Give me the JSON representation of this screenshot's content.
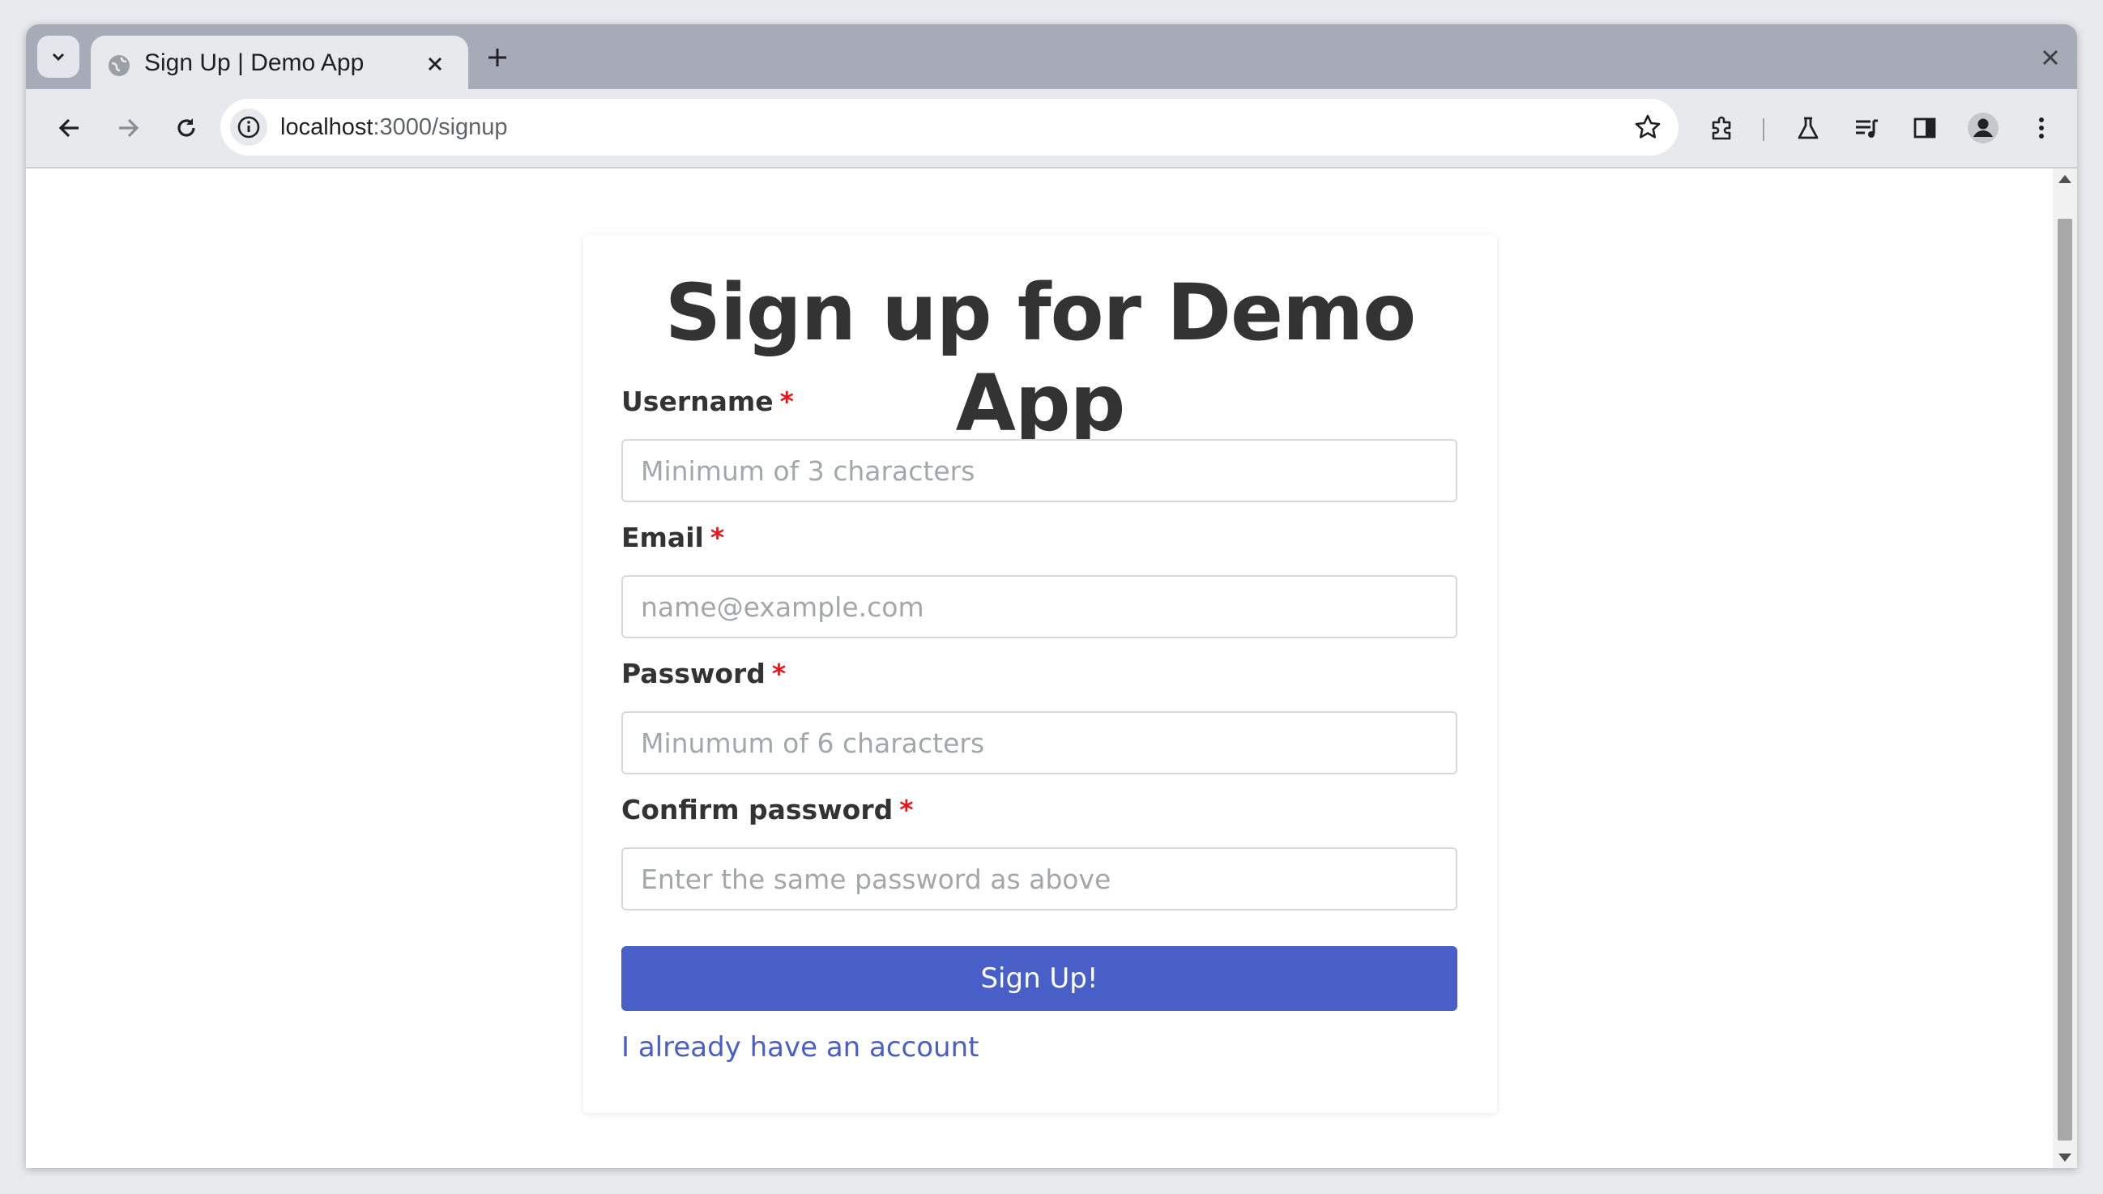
{
  "browser": {
    "tab": {
      "title": "Sign Up | Demo App"
    },
    "url": {
      "host": "localhost",
      "path": ":3000/signup"
    },
    "icons": [
      "tab-search-icon",
      "globe-icon",
      "close-icon",
      "plus-icon",
      "back-arrow-icon",
      "forward-arrow-icon",
      "reload-icon",
      "info-icon",
      "star-icon",
      "extensions-icon",
      "lab-flask-icon",
      "media-controls-icon",
      "side-panel-icon",
      "profile-icon",
      "more-vert-icon"
    ]
  },
  "page": {
    "heading": "Sign up for Demo App",
    "required_marker": "*",
    "fields": [
      {
        "label": "Username",
        "placeholder": "Minimum of 3 characters"
      },
      {
        "label": "Email",
        "placeholder": "name@example.com"
      },
      {
        "label": "Password",
        "placeholder": "Minumum of 6 characters"
      },
      {
        "label": "Confirm password",
        "placeholder": "Enter the same password as above"
      }
    ],
    "submit_label": "Sign Up!",
    "login_link": "I already have an account"
  },
  "colors": {
    "primary": "#485fc7",
    "required": "#e4161e",
    "heading": "#333333"
  }
}
